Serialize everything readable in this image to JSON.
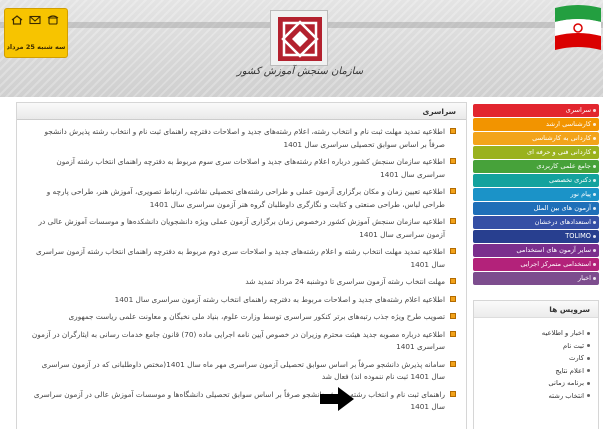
{
  "header": {
    "org_title": "سازمان سنجش آموزش کشور",
    "date": "سه شنبه 25 مرداد"
  },
  "news": {
    "heading": "سراسری",
    "items": [
      "اطلاعیه تمدید مهلت ثبت نام و انتخاب رشته، اعلام رشته‌های جدید و اصلاحات دفترچه راهنمای ثبت نام و انتخاب رشته پذیرش دانشجو صرفاً بر اساس سوابق تحصیلی سراسری سال 1401",
      "اطلاعیه سازمان سنجش کشور درباره اعلام رشته‌های جدید و اصلاحات سری سوم مربوط به دفترچه راهنمای انتخاب رشته آزمون سراسری سال 1401",
      "اطلاعیه تعیین زمان و مکان برگزاری آزمون عملی و طراحی رشته‌های تحصیلی نقاشی، ارتباط تصویری، آموزش هنر، طراحی پارچه و طراحی لباس، طراحی صنعتی و کتابت و نگارگری داوطلبان گروه هنر آزمون سراسری سال 1401",
      "اطلاعیه سازمان سنجش آموزش کشور درخصوص زمان برگزاری آزمون عملی ویژه دانشجویان دانشکده‌ها و موسسات آموزش عالی در آزمون سراسری سال 1401",
      "اطلاعیه تمدید مهلت انتخاب رشته و اعلام رشته‌های جدید و اصلاحات سری دوم مربوط به دفترچه راهنمای انتخاب رشته آزمون سراسری سال 1401",
      "مهلت انتخاب رشته آزمون سراسری تا دوشنبه 24 مرداد تمدید شد",
      "اطلاعیه اعلام رشته‌های جدید و اصلاحات مربوط به دفترچه راهنمای انتخاب رشته آزمون سراسری سال 1401",
      "تصویب طرح ویژه جذب رتبه‌های برتر کنکور سراسری توسط وزارت علوم، بنیاد ملی نخبگان و معاونت علمی ریاست جمهوری",
      "اطلاعیه درباره مصوبه جدید هیئت محترم وزیران در خصوص آیین نامه اجرایی ماده (70) قانون جامع خدمات رسانی به ایثارگران در آزمون سراسری 1401",
      "سامانه پذیرش دانشجو صرفاً بر اساس سوابق تحصیلی آزمون سراسری مهر ماه سال 1401(مختص داوطلبانی که در آزمون سراسری سال 1401 ثبت نام ننموده اند) فعال شد",
      "راهنمای ثبت نام و انتخاب رشته پذیرش دانشجو صرفاً بر اساس سوابق تحصیلی دانشگاه‌ها و موسسات آموزش عالی در آزمون سراسری سال 1401"
    ]
  },
  "menu": {
    "items": [
      {
        "label": "سراسری",
        "color": "#e2262f"
      },
      {
        "label": "کارشناسی ارشد",
        "color": "#f29400"
      },
      {
        "label": "کاردانی به کارشناسی",
        "color": "#f3a41b"
      },
      {
        "label": "کاردانی فنی و حرفه ای",
        "color": "#9ab21e"
      },
      {
        "label": "جامع علمی کاربردی",
        "color": "#47a23a"
      },
      {
        "label": "دکتری تخصصی",
        "color": "#14a29e"
      },
      {
        "label": "پیام نور",
        "color": "#1b93c8"
      },
      {
        "label": "آزمون های بین الملل",
        "color": "#1f6fb8"
      },
      {
        "label": "استعدادهای درخشان",
        "color": "#354fa5"
      },
      {
        "label": "TOLIMO",
        "color": "#283f8f"
      },
      {
        "label": "سایر آزمون های استخدامی",
        "color": "#7b2f8d"
      },
      {
        "label": "استخدامی متمرکز اجرایی",
        "color": "#b3227a"
      },
      {
        "label": "اخبار",
        "color": "#7d4d8e"
      }
    ]
  },
  "services": {
    "heading": "سرویس ها",
    "items": [
      "اخبار و اطلاعیه",
      "ثبت نام",
      "کارت",
      "اعلام نتایج",
      "برنامه زمانی",
      "انتخاب رشته"
    ]
  }
}
